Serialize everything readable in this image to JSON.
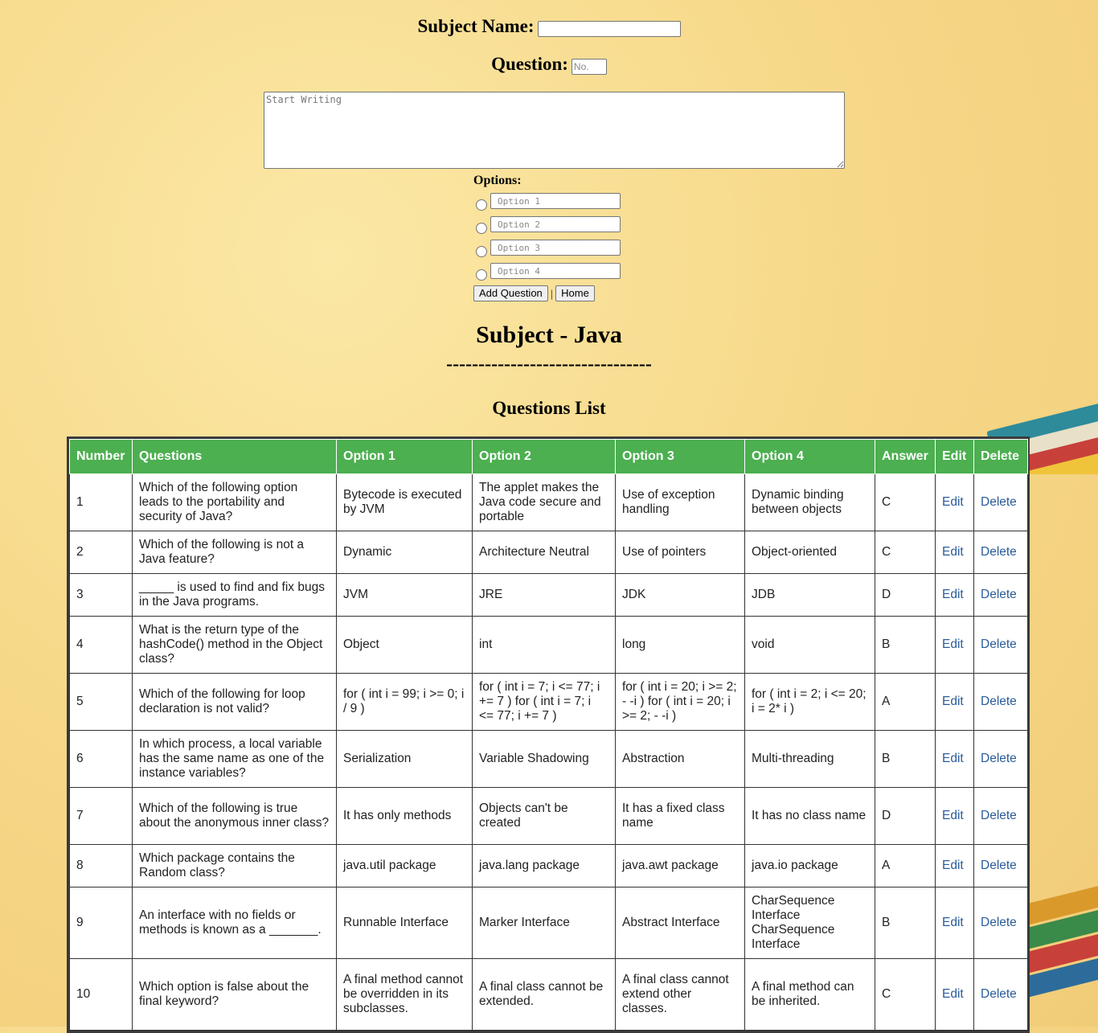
{
  "form": {
    "subject_label": "Subject Name:",
    "subject_value": "",
    "question_label": "Question:",
    "question_no_placeholder": "No.",
    "question_text_placeholder": "Start Writing",
    "options_label": "Options:",
    "option_placeholders": [
      "Option 1",
      "Option 2",
      "Option 3",
      "Option 4"
    ],
    "add_button": "Add Question",
    "separator": "|",
    "home_button": "Home"
  },
  "subject_title": "Subject - Java",
  "divider": "--------------------------------",
  "list_title": "Questions List",
  "table": {
    "headers": [
      "Number",
      "Questions",
      "Option 1",
      "Option 2",
      "Option 3",
      "Option 4",
      "Answer",
      "Edit",
      "Delete"
    ],
    "rows": [
      {
        "number": "1",
        "question": "Which of the following option leads to the portability and security of Java?",
        "o1": "Bytecode is executed by JVM",
        "o2": "The applet makes the Java code secure and portable",
        "o3": "Use of exception handling",
        "o4": "Dynamic binding between objects",
        "answer": "C",
        "edit": "Edit",
        "delete": "Delete"
      },
      {
        "number": "2",
        "question": "Which of the following is not a Java feature?",
        "o1": "Dynamic",
        "o2": "Architecture Neutral",
        "o3": "Use of pointers",
        "o4": "Object-oriented",
        "answer": "C",
        "edit": "Edit",
        "delete": "Delete"
      },
      {
        "number": "3",
        "question": "_____ is used to find and fix bugs in the Java programs.",
        "o1": "JVM",
        "o2": "JRE",
        "o3": "JDK",
        "o4": "JDB",
        "answer": "D",
        "edit": "Edit",
        "delete": "Delete"
      },
      {
        "number": "4",
        "question": "What is the return type of the hashCode() method in the Object class?",
        "o1": "Object",
        "o2": "int",
        "o3": "long",
        "o4": "void",
        "answer": "B",
        "edit": "Edit",
        "delete": "Delete"
      },
      {
        "number": "5",
        "question": "Which of the following for loop declaration is not valid?",
        "o1": "for ( int i = 99; i >= 0; i / 9 )",
        "o2": "for ( int i = 7; i <= 77; i += 7 ) for ( int i = 7; i <= 77; i += 7 )",
        "o3": "for ( int i = 20; i >= 2; - -i ) for ( int i = 20; i >= 2; - -i )",
        "o4": "for ( int i = 2; i <= 20; i = 2* i )",
        "answer": "A",
        "edit": "Edit",
        "delete": "Delete"
      },
      {
        "number": "6",
        "question": "In which process, a local variable has the same name as one of the instance variables?",
        "o1": "Serialization",
        "o2": "Variable Shadowing",
        "o3": "Abstraction",
        "o4": "Multi-threading",
        "answer": "B",
        "edit": "Edit",
        "delete": "Delete"
      },
      {
        "number": "7",
        "question": "Which of the following is true about the anonymous inner class?",
        "o1": "It has only methods",
        "o2": "Objects can't be created",
        "o3": "It has a fixed class name",
        "o4": "It has no class name",
        "answer": "D",
        "edit": "Edit",
        "delete": "Delete"
      },
      {
        "number": "8",
        "question": "Which package contains the Random class?",
        "o1": "java.util package",
        "o2": "java.lang package",
        "o3": "java.awt package",
        "o4": "java.io package",
        "answer": "A",
        "edit": "Edit",
        "delete": "Delete"
      },
      {
        "number": "9",
        "question": "An interface with no fields or methods is known as a _______.",
        "o1": "Runnable Interface",
        "o2": "Marker Interface",
        "o3": "Abstract Interface",
        "o4": "CharSequence Interface CharSequence Interface",
        "answer": "B",
        "edit": "Edit",
        "delete": "Delete"
      },
      {
        "number": "10",
        "question": "Which option is false about the final keyword?",
        "o1": "A final method cannot be overridden in its subclasses.",
        "o2": "A final class cannot be extended.",
        "o3": "A final class cannot extend other classes.",
        "o4": "A final method can be inherited.",
        "answer": "C",
        "edit": "Edit",
        "delete": "Delete"
      }
    ]
  },
  "colors": {
    "header_green": "#4caf50",
    "link_blue": "#2a5c9a",
    "background": "#f7d98a"
  }
}
